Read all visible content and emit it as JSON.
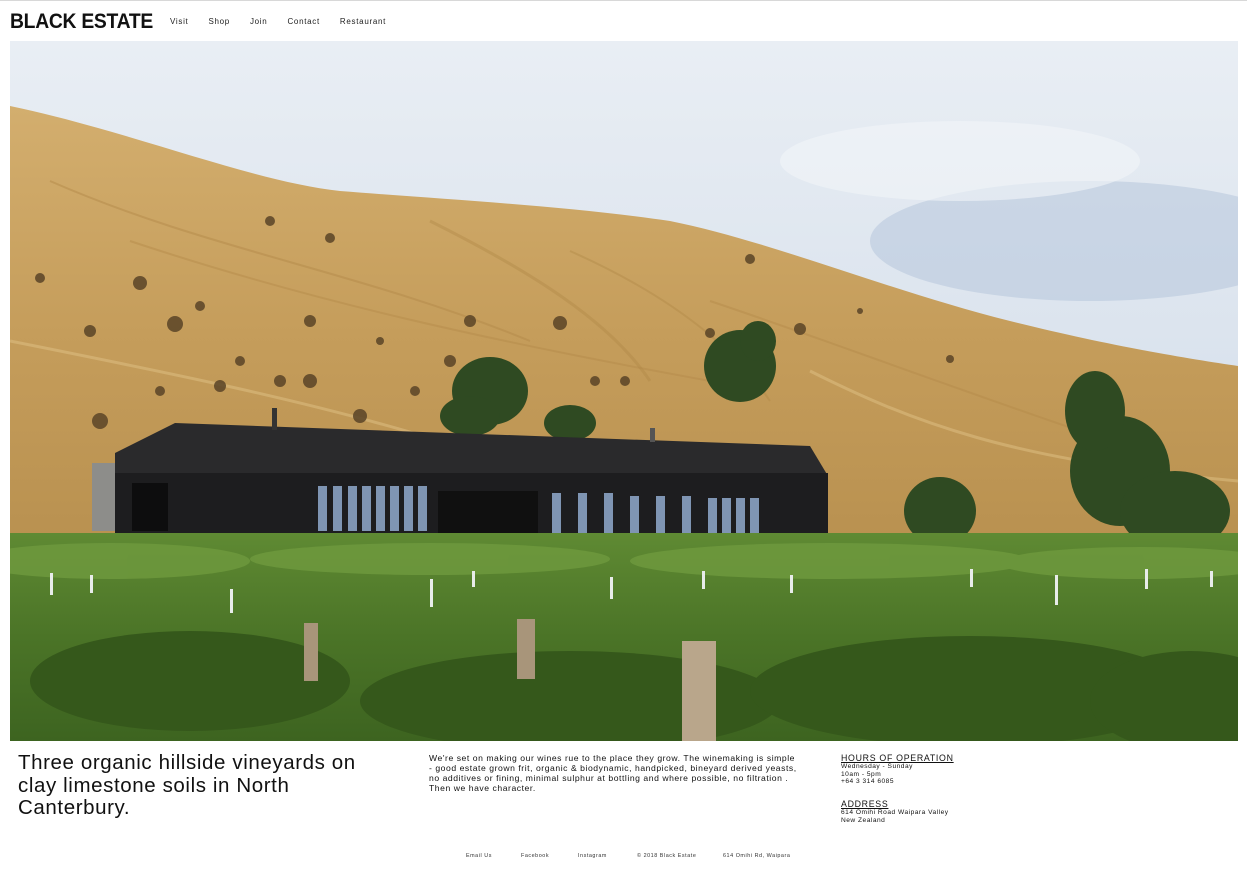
{
  "brand": {
    "logo_text": "BLACK ESTATE"
  },
  "nav": {
    "items": [
      {
        "label": "Visit"
      },
      {
        "label": "Shop"
      },
      {
        "label": "Join"
      },
      {
        "label": "Contact"
      },
      {
        "label": "Restaurant"
      }
    ]
  },
  "hero": {
    "image_subject": "winery-building-vineyard-hillside"
  },
  "content": {
    "tagline": "Three organic hillside vineyards on clay limestone soils in North Canterbury.",
    "intro": "We're set on making our wines rue to the place they grow. The winemaking is simple - good estate grown frit, organic & biodynamic, handpicked, bineyard derived yeasts, no additives or fining, minimal sulphur at bottling and where possible, no filtration . Then we have character."
  },
  "hours": {
    "heading": "HOURS OF OPERATION",
    "days": "Wednesday - Sunday",
    "time": "10am - 5pm",
    "phone": "+64 3 314 6085"
  },
  "address": {
    "heading": "ADDRESS",
    "line1": "614 Omihi Road Waipara Valley",
    "line2": "New Zealand"
  },
  "footer": {
    "email": "Email Us",
    "facebook": "Facebook",
    "instagram": "Instagram",
    "copyright": "© 2018 Black Estate",
    "address": "614 Omihi Rd, Waipara"
  },
  "colors": {
    "background": "#ffffff",
    "text": "#111111",
    "sky": "#dfe6ef",
    "hill": "#c9a465",
    "vines": "#4f7a2a",
    "building": "#1d1d1f"
  }
}
